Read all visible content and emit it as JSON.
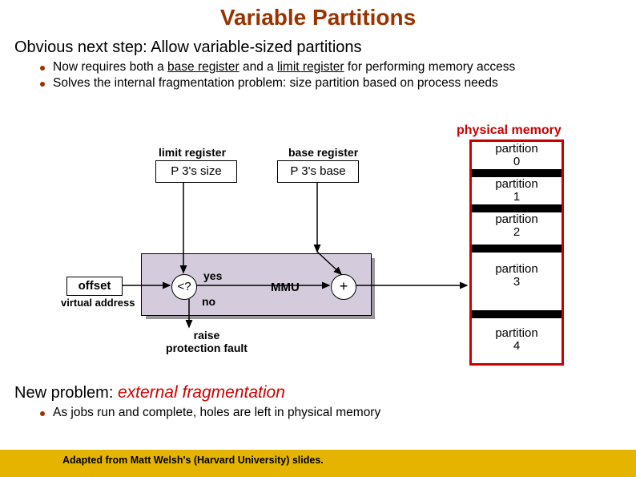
{
  "title": "Variable Partitions",
  "subtitle": "Obvious next step: Allow variable-sized partitions",
  "bullets": [
    {
      "prefix": "Now requires both a ",
      "u1": "base register",
      "mid": " and a ",
      "u2": "limit register",
      "suffix": " for performing memory access"
    },
    {
      "text": "Solves the internal fragmentation problem: size partition based on process needs"
    }
  ],
  "diagram": {
    "phys_memory": "physical memory",
    "limit_label": "limit register",
    "limit_value": "P 3's size",
    "base_label": "base register",
    "base_value": "P 3's base",
    "offset": "offset",
    "virtual_address": "virtual address",
    "comparator": "<?",
    "yes": "yes",
    "no": "no",
    "mmu": "MMU",
    "adder": "+",
    "fault1": "raise",
    "fault2": "protection fault",
    "partitions": [
      "partition\n0",
      "partition\n1",
      "partition\n2",
      "partition\n3",
      "partition\n4"
    ]
  },
  "new_problem": {
    "prefix": "New problem: ",
    "term": "external fragmentation"
  },
  "bullet2": "As jobs run and complete, holes are left in physical memory",
  "footer": "Adapted from Matt Welsh's (Harvard University) slides."
}
